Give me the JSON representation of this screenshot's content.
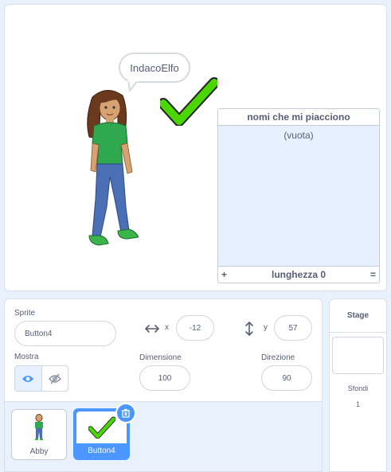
{
  "stage": {
    "speech_bubble": "IndacoElfo",
    "list_monitor": {
      "title": "nomi che mi piacciono",
      "empty_text": "(vuota)",
      "add_label": "+",
      "length_label": "lunghezza 0",
      "resize_label": "="
    }
  },
  "sprite_info": {
    "sprite_label": "Sprite",
    "sprite_name": "Button4",
    "x_label": "x",
    "x_value": "-12",
    "y_label": "y",
    "y_value": "57",
    "show_label": "Mostra",
    "size_label": "Dimensione",
    "size_value": "100",
    "direction_label": "Direzione",
    "direction_value": "90"
  },
  "sprites": [
    {
      "name": "Abby",
      "selected": false
    },
    {
      "name": "Button4",
      "selected": true
    }
  ],
  "stage_pane": {
    "title": "Stage",
    "backdrops_label": "Sfondi",
    "backdrops_count": "1"
  },
  "colors": {
    "accent": "#4c97ff",
    "check_green": "#4cd600"
  }
}
